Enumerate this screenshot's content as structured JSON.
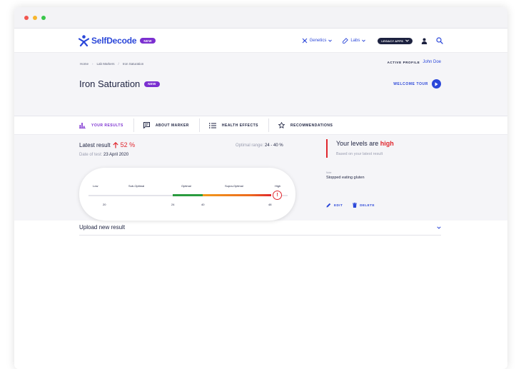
{
  "brand": {
    "name": "SelfDecode",
    "badge": "NEW",
    "color": "#2b47d9",
    "badge_color": "#7b2fd0"
  },
  "nav": {
    "genetics": "Genetics",
    "labs": "Labs",
    "legacy_apps": "LEGACY APPS"
  },
  "breadcrumb": [
    "Home",
    "Lab Markers",
    "Iron Saturation"
  ],
  "profile": {
    "label": "ACTIVE PROFILE",
    "name": "John Doe"
  },
  "page": {
    "title": "Iron Saturation",
    "badge": "NEW",
    "welcome_tour": "WELCOME TOUR"
  },
  "tabs": [
    {
      "label": "YOUR RESULTS",
      "icon": "bar-chart-icon",
      "active": true
    },
    {
      "label": "ABOUT MARKER",
      "icon": "chat-bubble-icon",
      "active": false
    },
    {
      "label": "HEALTH EFFECTS",
      "icon": "list-icon",
      "active": false
    },
    {
      "label": "RECOMMENDATIONS",
      "icon": "star-icon",
      "active": false
    }
  ],
  "result": {
    "latest_label": "Latest result",
    "value": "52 %",
    "date_label": "Date of test:",
    "date": "23 April 2020",
    "optimal_label": "Optimal range:",
    "optimal_range": "24 - 40 %",
    "status_color": "#e0262d"
  },
  "gauge": {
    "labels": [
      "Low",
      "Sub-Optimal",
      "Optimal",
      "Supra-Optimal",
      "High"
    ],
    "ticks": [
      "20",
      "24",
      "40",
      "48"
    ],
    "optimal_color": "#2a9b3f",
    "supra_color": "#f29a1c"
  },
  "levels": {
    "prefix": "Your levels are",
    "status": "high",
    "based_on": "Based on your latest result"
  },
  "note": {
    "label": "Note",
    "text": "Stopped eating gluten"
  },
  "actions": {
    "edit": "EDIT",
    "delete": "DELETE"
  },
  "upload": {
    "label": "Upload new result"
  }
}
